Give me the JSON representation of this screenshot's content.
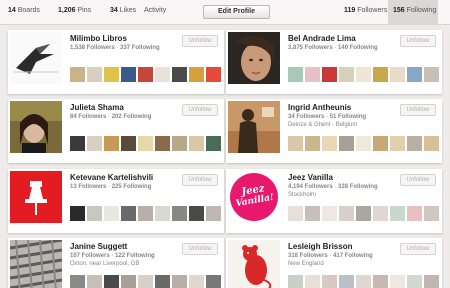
{
  "stats": {
    "boards_count": "14",
    "boards_label": "Boards",
    "pins_count": "1,206",
    "pins_label": "Pins",
    "likes_count": "34",
    "likes_label": "Likes",
    "activity_label": "Activity",
    "edit_profile_label": "Edit Profile",
    "followers_count": "119",
    "followers_label": "Followers",
    "following_count": "156",
    "following_label": "Following"
  },
  "unfollow_label": "Unfollow",
  "users": [
    {
      "name": "Milimbo Libros",
      "followers": "1,538 Followers",
      "following": "337 Following",
      "location": "",
      "avatar_icon": "origami-bird-icon",
      "pins": [
        "#c9b48a",
        "#d8cfc0",
        "#e0c24a",
        "#3a5a8c",
        "#c8453a",
        "#e8e2d8",
        "#4a4a4a",
        "#d6a13a",
        "#e54b3c",
        "#9fb8c8",
        "#6a7a5a",
        "#b8b0a8"
      ]
    },
    {
      "name": "Bel Andrade Lima",
      "followers": "3,875 Followers",
      "following": "140 Following",
      "location": "",
      "avatar_icon": "woman-portrait-icon",
      "pins": [
        "#a8c8b8",
        "#e8c0c8",
        "#c83a3a",
        "#d8d0b8",
        "#f0e6d8",
        "#c8a848",
        "#e8dcc8",
        "#88a8c8",
        "#c8c0b8",
        "#e0e0d0",
        "#d8b8a8",
        "#b8c8a0"
      ]
    },
    {
      "name": "Julieta Shama",
      "followers": "84 Followers",
      "following": "202 Following",
      "location": "",
      "avatar_icon": "woman-photo-icon",
      "pins": [
        "#3a3a3a",
        "#d8d0c0",
        "#c89858",
        "#5a4a3a",
        "#e8d8a8",
        "#8a6a4a",
        "#b8a888",
        "#d8c8a8",
        "#4a6a5a",
        "#e8e0d0",
        "#7a7a7a",
        "#c8b898"
      ]
    },
    {
      "name": "Ingrid Antheunis",
      "followers": "34 Followers",
      "following": "51 Following",
      "location": "Deinze & Ghent - Belgium",
      "avatar_icon": "shadow-silhouette-icon",
      "pins": [
        "#d8c8a8",
        "#c8b890",
        "#e8d8b8",
        "#a8a098",
        "#f0e8d8",
        "#c8a878",
        "#e0d0b0",
        "#b8b0a0",
        "#d8c098",
        "#a89878",
        "#e8e0c8",
        "#c0b8a8"
      ]
    },
    {
      "name": "Ketevane Kartelishvili",
      "followers": "13 Followers",
      "following": "225 Following",
      "location": "",
      "avatar_icon": "pushpin-icon",
      "pins": [
        "#2a2a2a",
        "#c8c8c0",
        "#e8e8e0",
        "#6a6a68",
        "#b8b0a8",
        "#d8d8d0",
        "#888880",
        "#4a4a48",
        "#c0b8b0",
        "#9a9a98",
        "#e0d8d0",
        "#585858"
      ]
    },
    {
      "name": "Jeez Vanilla",
      "followers": "4,194 Followers",
      "following": "338 Following",
      "location": "Stockholm",
      "avatar_icon": "jeez-vanilla-logo-icon",
      "logo_line1": "Jeez",
      "logo_line2": "Vanilla!",
      "pins": [
        "#e8e0d8",
        "#c8c0b8",
        "#f0e8e0",
        "#d8d0c8",
        "#a8a8a0",
        "#e0d8d0",
        "#c8d8d0",
        "#e8c0c0",
        "#d0c8c0",
        "#f0f0e8",
        "#b8c0b8",
        "#e0d0c8"
      ]
    },
    {
      "name": "Janine Suggett",
      "followers": "107 Followers",
      "following": "122 Following",
      "location": "Oxton, near Liverpool, GB",
      "avatar_icon": "pattern-photo-icon",
      "pins": [
        "#8a8a88",
        "#c8c0b8",
        "#4a4a4a",
        "#a8a098",
        "#d8d0c8",
        "#6a6a68",
        "#b8b0a8",
        "#e0d8d0",
        "#787878",
        "#c0c0b8",
        "#9a9890",
        "#5a5a58"
      ]
    },
    {
      "name": "Lesleigh Brisson",
      "followers": "318 Followers",
      "following": "417 Following",
      "location": "New England",
      "avatar_icon": "red-rat-illustration-icon",
      "pins": [
        "#c8d0c8",
        "#e8e0d8",
        "#d8c8c0",
        "#b8c0c8",
        "#e0d8d0",
        "#c8b8b0",
        "#f0e8e0",
        "#d0d8d0",
        "#c0b8b0",
        "#e8e8e0",
        "#b8b0a8",
        "#d8d0c8"
      ]
    }
  ]
}
